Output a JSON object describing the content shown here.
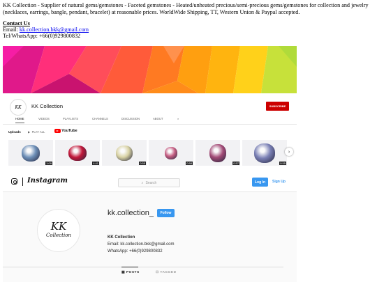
{
  "intro": {
    "text": "KK Collection - Supplier of natural gems/gemstones - Faceted gemstones - Heated/unheated precious/semi-precious gems/gemstones for collection and jewelry (necklaces, earrings, bangle, pendant, bracelet) at reasonable prices. WorldWide Shipping, TT, Western Union & Paypal accepted."
  },
  "contact": {
    "heading": "Contact Us",
    "email_label": "Email: ",
    "email": "kk.collection.bkk@gmail.com",
    "phone": "Tel/WhatsApp: +66(0)929800832"
  },
  "youtube": {
    "channel_name": "KK Collection",
    "subscribe_label": "SUBSCRIBE",
    "tabs": [
      "HOME",
      "VIDEOS",
      "PLAYLISTS",
      "CHANNELS",
      "DISCUSSION",
      "ABOUT"
    ],
    "uploads_label": "Uploads",
    "play_all_label": "PLAY ALL",
    "logo_text": "YouTube",
    "videos": [
      {
        "duration": "1:09",
        "gem_color": "#6d8fb7"
      },
      {
        "duration": "4:41",
        "gem_color": "#c2183a"
      },
      {
        "duration": "0:55",
        "gem_color": "#d9d3a5"
      },
      {
        "duration": "0:58",
        "gem_color": "#c65f83"
      },
      {
        "duration": "0:57",
        "gem_color": "#a24b76"
      },
      {
        "duration": "0:55",
        "gem_color": "#7a80b5"
      }
    ]
  },
  "instagram": {
    "wordmark": "Instagram",
    "search_placeholder": "Search",
    "login_label": "Log In",
    "signup_label": "Sign Up",
    "username": "kk.collection_",
    "follow_label": "Follow",
    "full_name": "KK Collection",
    "bio_email": "Email: kk.collection.bkk@gmail.com",
    "bio_whatsapp": "WhatsApp: +66(0)929800832",
    "tab_posts": "POSTS",
    "tab_tagged": "TAGGED",
    "avatar_text_top": "KK",
    "avatar_text_bottom": "Collection"
  },
  "colors": {
    "youtube_red": "#cc0000",
    "instagram_blue": "#3897f0",
    "link": "#0000ee"
  }
}
